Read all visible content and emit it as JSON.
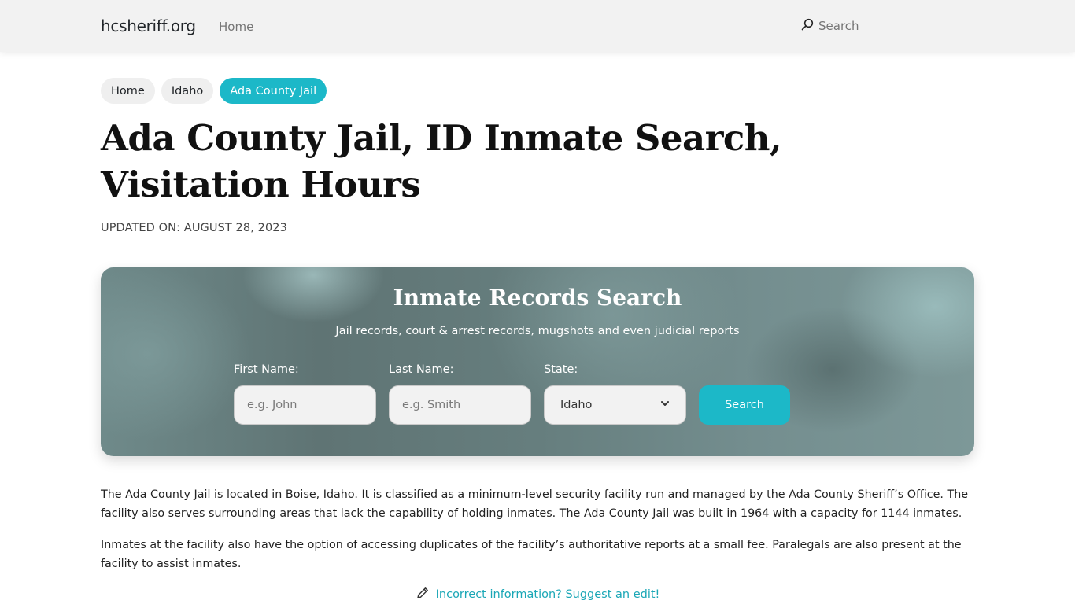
{
  "nav": {
    "brand": "hcsheriff.org",
    "home_label": "Home",
    "search_label": "Search",
    "search_icon": "search-icon"
  },
  "breadcrumb": [
    {
      "label": "Home",
      "active": false
    },
    {
      "label": "Idaho",
      "active": false
    },
    {
      "label": "Ada County Jail",
      "active": true
    }
  ],
  "page": {
    "title": "Ada County Jail, ID Inmate Search, Visitation Hours",
    "updated": "UPDATED ON: AUGUST 28, 2023"
  },
  "search_card": {
    "title": "Inmate Records Search",
    "subtitle": "Jail records, court & arrest records, mugshots and even judicial reports",
    "first_name": {
      "label": "First Name:",
      "placeholder": "e.g. John",
      "value": ""
    },
    "last_name": {
      "label": "Last Name:",
      "placeholder": "e.g. Smith",
      "value": ""
    },
    "state": {
      "label": "State:",
      "selected": "Idaho"
    },
    "button_label": "Search"
  },
  "content": {
    "paragraphs": [
      "The Ada County Jail is located in Boise, Idaho. It is classified as a minimum-level security facility run and managed by the Ada County Sheriff’s Office. The facility also serves surrounding areas that lack the capability of holding inmates. The Ada County Jail was built in 1964 with a capacity for 1144 inmates.",
      "Inmates at the facility also have the option of accessing duplicates of the facility’s authoritative reports at a small fee. Paralegals are also present at the facility to assist inmates."
    ],
    "suggest_edit": "Incorrect information? Suggest an edit!"
  },
  "colors": {
    "accent": "#1cb8c8",
    "link": "#1aa7b6",
    "nav_bg": "#f2f2f2"
  }
}
